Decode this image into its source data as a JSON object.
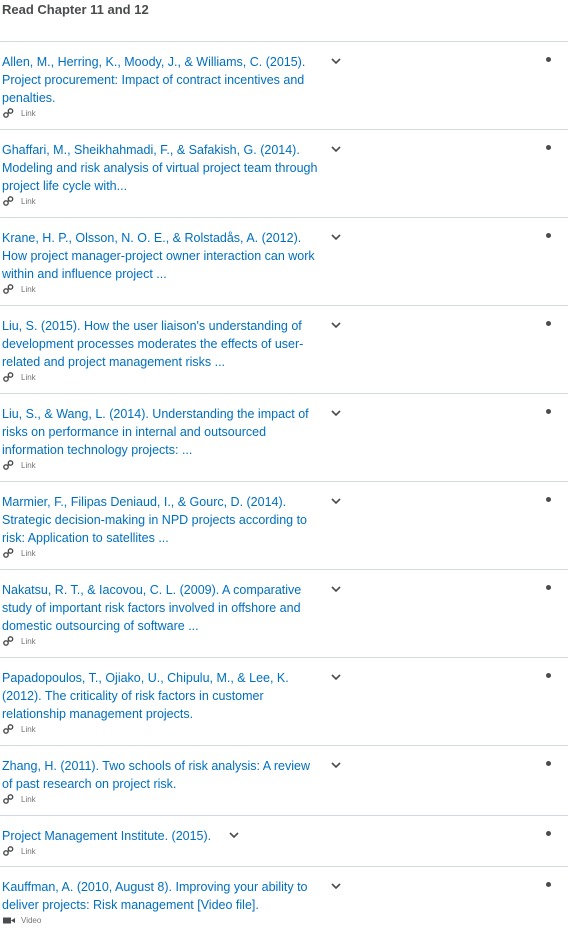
{
  "section": {
    "title": "Read Chapter 11 and 12"
  },
  "items": [
    {
      "title": "Allen, M., Herring, K., Moody, J., & Williams, C. (2015). Project procurement: Impact of contract incentives and penalties.",
      "type": "Link",
      "icon": "link-icon"
    },
    {
      "title": "Ghaffari, M., Sheikhahmadi, F., & Safakish, G. (2014). Modeling and risk analysis of virtual project team through project life cycle with...",
      "type": "Link",
      "icon": "link-icon"
    },
    {
      "title": "Krane, H. P., Olsson, N. O. E., & Rolstadås, A. (2012). How project manager-project owner interaction can work within and influence project ...",
      "type": "Link",
      "icon": "link-icon"
    },
    {
      "title": "Liu, S. (2015). How the user liaison's understanding of development processes moderates the effects of user-related and project management risks ...",
      "type": "Link",
      "icon": "link-icon"
    },
    {
      "title": "Liu, S., & Wang, L. (2014). Understanding the impact of risks on performance in internal and outsourced information technology projects: ...",
      "type": "Link",
      "icon": "link-icon"
    },
    {
      "title": "Marmier, F., Filipas Deniaud, I., & Gourc, D. (2014). Strategic decision-making in NPD projects according to risk: Application to satellites ...",
      "type": "Link",
      "icon": "link-icon"
    },
    {
      "title": "Nakatsu, R. T., & Iacovou, C. L. (2009). A comparative study of important risk factors involved in offshore and domestic outsourcing of software ...",
      "type": "Link",
      "icon": "link-icon"
    },
    {
      "title": "Papadopoulos, T., Ojiako, U., Chipulu, M., & Lee, K. (2012). The criticality of risk factors in customer relationship management projects.",
      "type": "Link",
      "icon": "link-icon"
    },
    {
      "title": "Zhang, H. (2011). Two schools of risk analysis: A review of past research on project risk.",
      "type": "Link",
      "icon": "link-icon"
    },
    {
      "title": "Project Management Institute. (2015).",
      "type": "Link",
      "icon": "link-icon"
    },
    {
      "title": "Kauffman, A. (2010, August 8). Improving your ability to deliver projects: Risk management [Video file].",
      "type": "Video",
      "icon": "video-icon"
    }
  ],
  "colors": {
    "link": "#006fbf",
    "text": "#494c4e",
    "divider": "#d3d9e3",
    "meta": "#767676"
  }
}
